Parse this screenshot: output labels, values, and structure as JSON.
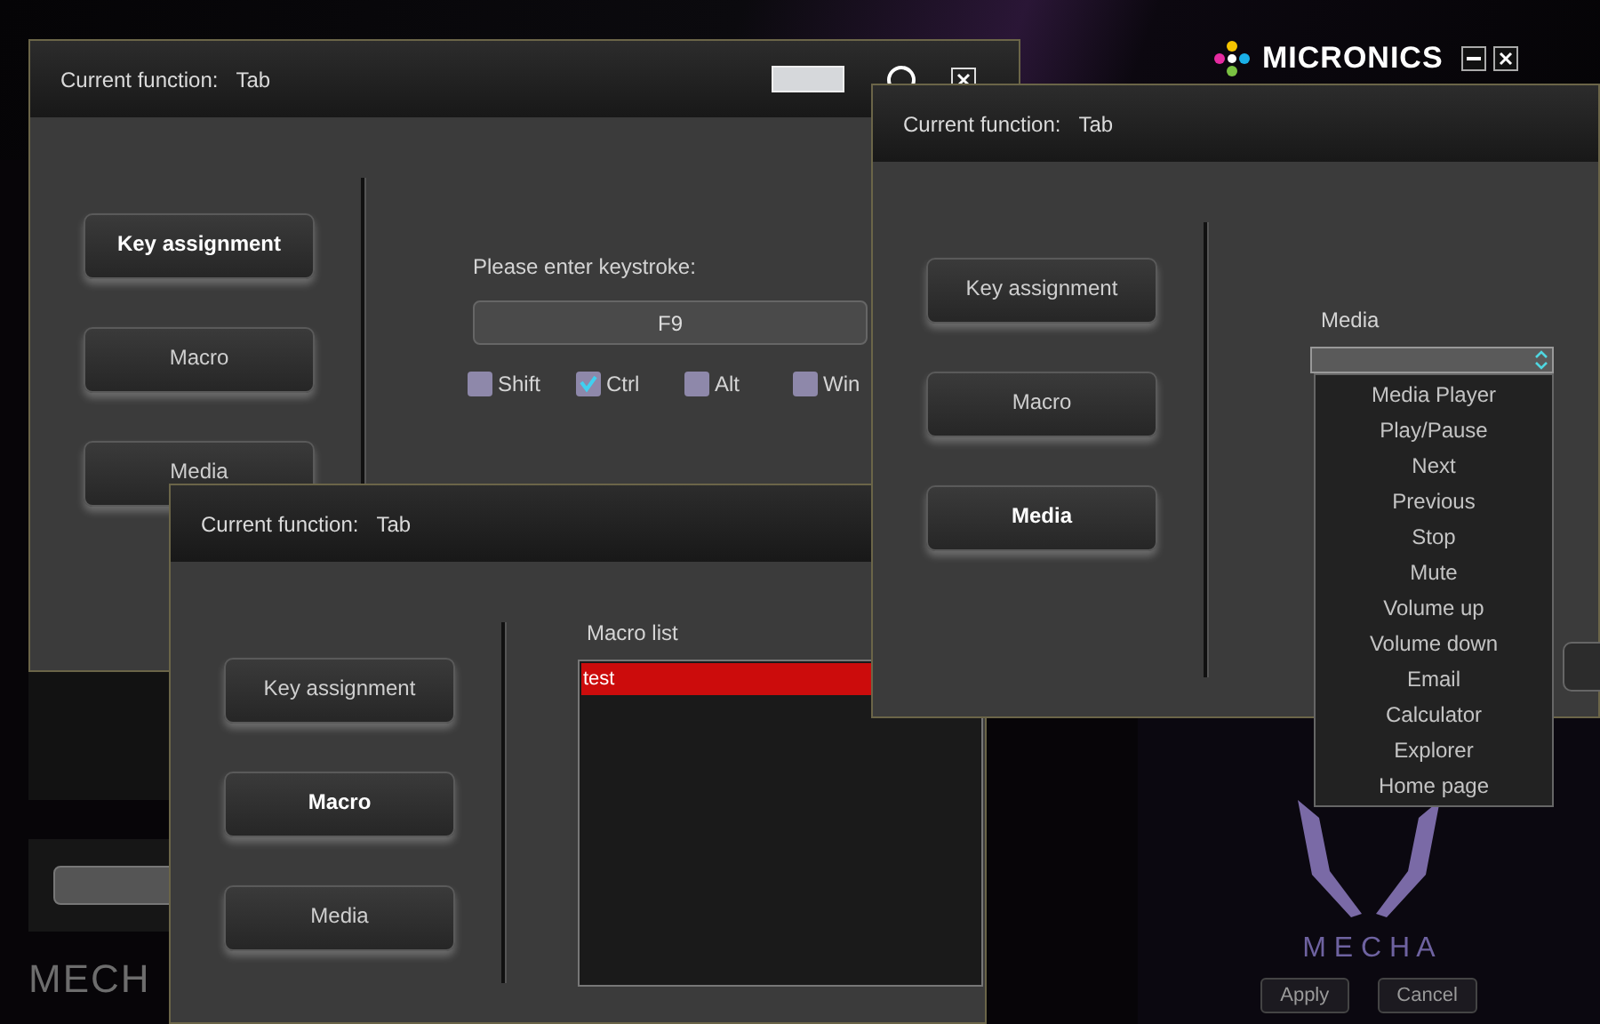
{
  "app": {
    "logo": "MICRONICS",
    "model": "MECH",
    "logo_letters": "M E C H A",
    "buttons": [
      "Apply",
      "Cancel"
    ]
  },
  "windows": [
    {
      "title_label": "Current function:",
      "title_value": "Tab",
      "tools": true,
      "nav": [
        {
          "label": "Key assignment",
          "selected": true
        },
        {
          "label": "Macro",
          "selected": false
        },
        {
          "label": "Media",
          "selected": false
        }
      ],
      "panel": {
        "kind": "keystroke",
        "label": "Please enter keystroke:",
        "value": "F9",
        "modifiers": [
          {
            "label": "Shift",
            "checked": false
          },
          {
            "label": "Ctrl",
            "checked": true
          },
          {
            "label": "Alt",
            "checked": false
          },
          {
            "label": "Win",
            "checked": false
          }
        ]
      }
    },
    {
      "title_label": "Current function:",
      "title_value": "Tab",
      "tools": false,
      "nav": [
        {
          "label": "Key assignment",
          "selected": false
        },
        {
          "label": "Macro",
          "selected": true
        },
        {
          "label": "Media",
          "selected": false
        }
      ],
      "panel": {
        "kind": "macro_list",
        "label": "Macro list",
        "items": [
          {
            "label": "test",
            "selected": true
          }
        ]
      }
    },
    {
      "title_label": "Current function:",
      "title_value": "Tab",
      "tools": false,
      "nav": [
        {
          "label": "Key assignment",
          "selected": false
        },
        {
          "label": "Macro",
          "selected": false
        },
        {
          "label": "Media",
          "selected": true
        }
      ],
      "panel": {
        "kind": "media",
        "label": "Media",
        "dropdown": {
          "expanded": true,
          "options": [
            "Media Player",
            "Play/Pause",
            "Next",
            "Previous",
            "Stop",
            "Mute",
            "Volume up",
            "Volume down",
            "Email",
            "Calculator",
            "Explorer",
            "Home page"
          ]
        }
      }
    }
  ]
}
